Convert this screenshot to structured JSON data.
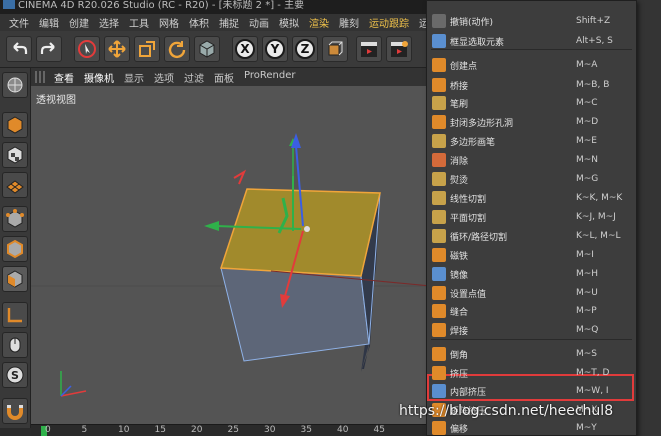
{
  "window": {
    "title": "CINEMA 4D R20.026 Studio (RC - R20) - [未标题 2 *] - 主要"
  },
  "menubar": {
    "items": [
      {
        "label": "文件",
        "hl": false
      },
      {
        "label": "编辑",
        "hl": false
      },
      {
        "label": "创建",
        "hl": false
      },
      {
        "label": "选择",
        "hl": false
      },
      {
        "label": "工具",
        "hl": false
      },
      {
        "label": "网格",
        "hl": false
      },
      {
        "label": "体积",
        "hl": false
      },
      {
        "label": "捕捉",
        "hl": false
      },
      {
        "label": "动画",
        "hl": false
      },
      {
        "label": "模拟",
        "hl": false
      },
      {
        "label": "渲染",
        "hl": true
      },
      {
        "label": "雕刻",
        "hl": false
      },
      {
        "label": "运动跟踪",
        "hl": true
      },
      {
        "label": "运动",
        "hl": false
      }
    ]
  },
  "toolbar": {
    "axis_x": "X",
    "axis_y": "Y",
    "axis_z": "Z"
  },
  "viewport_menu": {
    "items": [
      "查看",
      "摄像机",
      "显示",
      "选项",
      "过滤",
      "面板",
      "ProRender"
    ]
  },
  "viewport": {
    "label": "透视视图"
  },
  "timeline": {
    "ticks": [
      "0",
      "5",
      "10",
      "15",
      "20",
      "25",
      "30",
      "35",
      "40",
      "45"
    ]
  },
  "context_menu": {
    "items": [
      {
        "label": "撤销(动作)",
        "shortcut": "Shift+Z",
        "color": "#6a6a6a"
      },
      {
        "label": "框显选取元素",
        "shortcut": "Alt+S, S",
        "color": "#5a8fd0"
      },
      {
        "label": "创建点",
        "shortcut": "M~A",
        "color": "#e08a2a"
      },
      {
        "label": "桥接",
        "shortcut": "M~B, B",
        "color": "#e08a2a"
      },
      {
        "label": "笔刷",
        "shortcut": "M~C",
        "color": "#c7a24a"
      },
      {
        "label": "封闭多边形孔洞",
        "shortcut": "M~D",
        "color": "#e08a2a"
      },
      {
        "label": "多边形画笔",
        "shortcut": "M~E",
        "color": "#c7a24a"
      },
      {
        "label": "消除",
        "shortcut": "M~N",
        "color": "#d46a3a"
      },
      {
        "label": "熨烫",
        "shortcut": "M~G",
        "color": "#c7a24a"
      },
      {
        "label": "线性切割",
        "shortcut": "K~K, M~K",
        "color": "#c7a24a"
      },
      {
        "label": "平面切割",
        "shortcut": "K~J, M~J",
        "color": "#c7a24a"
      },
      {
        "label": "循环/路径切割",
        "shortcut": "K~L, M~L",
        "color": "#c7a24a"
      },
      {
        "label": "磁铁",
        "shortcut": "M~I",
        "color": "#e08a2a"
      },
      {
        "label": "镜像",
        "shortcut": "M~H",
        "color": "#5a8fd0"
      },
      {
        "label": "设置点值",
        "shortcut": "M~U",
        "color": "#e08a2a"
      },
      {
        "label": "缝合",
        "shortcut": "M~P",
        "color": "#e08a2a"
      },
      {
        "label": "焊接",
        "shortcut": "M~Q",
        "color": "#e08a2a"
      },
      {
        "label": "倒角",
        "shortcut": "M~S",
        "color": "#e08a2a"
      },
      {
        "label": "挤压",
        "shortcut": "M~T, D",
        "color": "#e08a2a"
      },
      {
        "label": "内部挤压",
        "shortcut": "M~W, I",
        "color": "#5a8fd0"
      },
      {
        "label": "矩阵挤压",
        "shortcut": "M~X",
        "color": "#e08a2a"
      },
      {
        "label": "偏移",
        "shortcut": "M~Y",
        "color": "#e08a2a"
      }
    ]
  },
  "watermark": "https://blog.csdn.net/heechul8",
  "colors": {
    "selection_face": "#a18a2c",
    "highlight_box": "#e13b3b",
    "axis_x": "#e23b3b",
    "axis_y": "#2fb14a",
    "axis_z": "#3b5fe2"
  }
}
